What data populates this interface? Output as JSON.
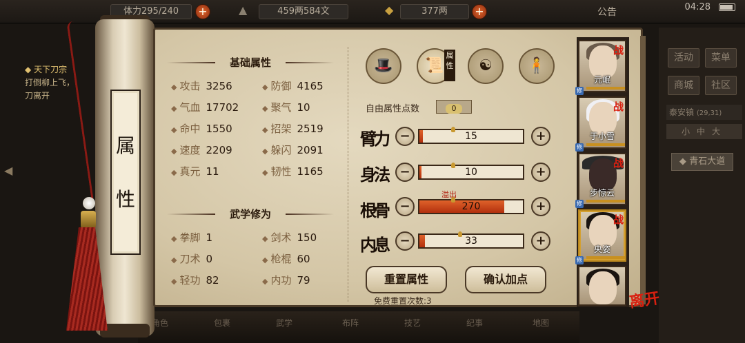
{
  "topbar": {
    "stamina_label": "体力",
    "stamina_value": "295/240",
    "money": "459两584文",
    "gold": "377两",
    "notice": "公告",
    "time": "04:28"
  },
  "quest": {
    "title": "天下刀宗",
    "line1": "打倒柳上飞，",
    "line2": "刀离开"
  },
  "title": {
    "char1": "属",
    "char2": "性"
  },
  "sections": {
    "basic": "基础属性",
    "martial": "武学修为"
  },
  "basic_stats": [
    {
      "label": "攻击",
      "value": "3256"
    },
    {
      "label": "防御",
      "value": "4165"
    },
    {
      "label": "气血",
      "value": "17702"
    },
    {
      "label": "聚气",
      "value": "10"
    },
    {
      "label": "命中",
      "value": "1550"
    },
    {
      "label": "招架",
      "value": "2519"
    },
    {
      "label": "速度",
      "value": "2209"
    },
    {
      "label": "躲闪",
      "value": "2091"
    },
    {
      "label": "真元",
      "value": "11"
    },
    {
      "label": "韧性",
      "value": "1165"
    }
  ],
  "martial_stats": [
    {
      "label": "拳脚",
      "value": "1"
    },
    {
      "label": "剑术",
      "value": "150"
    },
    {
      "label": "刀术",
      "value": "0"
    },
    {
      "label": "枪棍",
      "value": "60"
    },
    {
      "label": "轻功",
      "value": "82"
    },
    {
      "label": "内功",
      "value": "79"
    }
  ],
  "tabs": {
    "attr_tag": "属性"
  },
  "free_points": {
    "label": "自由属性点数",
    "value": "0"
  },
  "attributes": [
    {
      "name": "臂力",
      "value": "15",
      "fill": 0.03
    },
    {
      "name": "身法",
      "value": "10",
      "fill": 0.02
    },
    {
      "name": "根骨",
      "value": "270",
      "fill": 0.82,
      "overflow": "溢出"
    },
    {
      "name": "内息",
      "value": "33",
      "fill": 0.05
    }
  ],
  "buttons": {
    "reset": "重置属性",
    "confirm": "确认加点",
    "free_reset": "免费重置次数:3",
    "minus": "−",
    "plus": "+"
  },
  "characters": [
    {
      "name": "元岷",
      "battle": "战",
      "cult": "修"
    },
    {
      "name": "于小雪",
      "battle": "战",
      "cult": "修"
    },
    {
      "name": "步惊云",
      "battle": "战",
      "cult": "修"
    },
    {
      "name": "央姿",
      "battle": "战",
      "cult": "修"
    },
    {
      "name": "",
      "battle": "",
      "cult": ""
    }
  ],
  "leave": "离开",
  "right_menu": {
    "activity": "活动",
    "menu": "菜单",
    "shop": "商城",
    "community": "社区",
    "location": "泰安镇",
    "coords": "(29,31)",
    "tabs": "小中大",
    "road": "青石大道"
  },
  "bottom_menu": [
    "角色",
    "包裹",
    "武学",
    "布阵",
    "技艺",
    "纪事",
    "地图"
  ]
}
